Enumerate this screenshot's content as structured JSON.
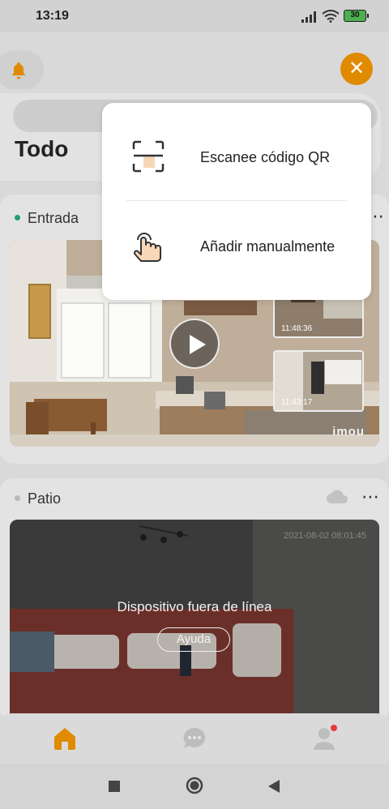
{
  "status_bar": {
    "time": "13:19",
    "battery": "30"
  },
  "header": {
    "group_title": "Todo"
  },
  "devices": [
    {
      "name": "Entrada",
      "status_color": "#22a06b",
      "thumbnails": [
        {
          "time": "11:48:36"
        },
        {
          "time": "11:43:17"
        }
      ],
      "watermark": "imou"
    },
    {
      "name": "Patio",
      "status_color": "#b9b9b9",
      "timestamp": "2021-08-02 08:01:45",
      "offline_message": "Dispositivo fuera de línea",
      "help_label": "Ayuda"
    }
  ],
  "add_menu": {
    "items": [
      {
        "label": "Escanee código QR",
        "icon": "qr-scan-icon"
      },
      {
        "label": "Añadir manualmente",
        "icon": "hand-tap-icon"
      }
    ]
  },
  "bottom_nav": [
    {
      "icon": "home-icon",
      "active": true
    },
    {
      "icon": "message-icon",
      "active": false
    },
    {
      "icon": "profile-icon",
      "active": false,
      "badge": true
    }
  ],
  "colors": {
    "accent": "#e08a00",
    "online": "#22a06b",
    "badge": "#e53935"
  }
}
